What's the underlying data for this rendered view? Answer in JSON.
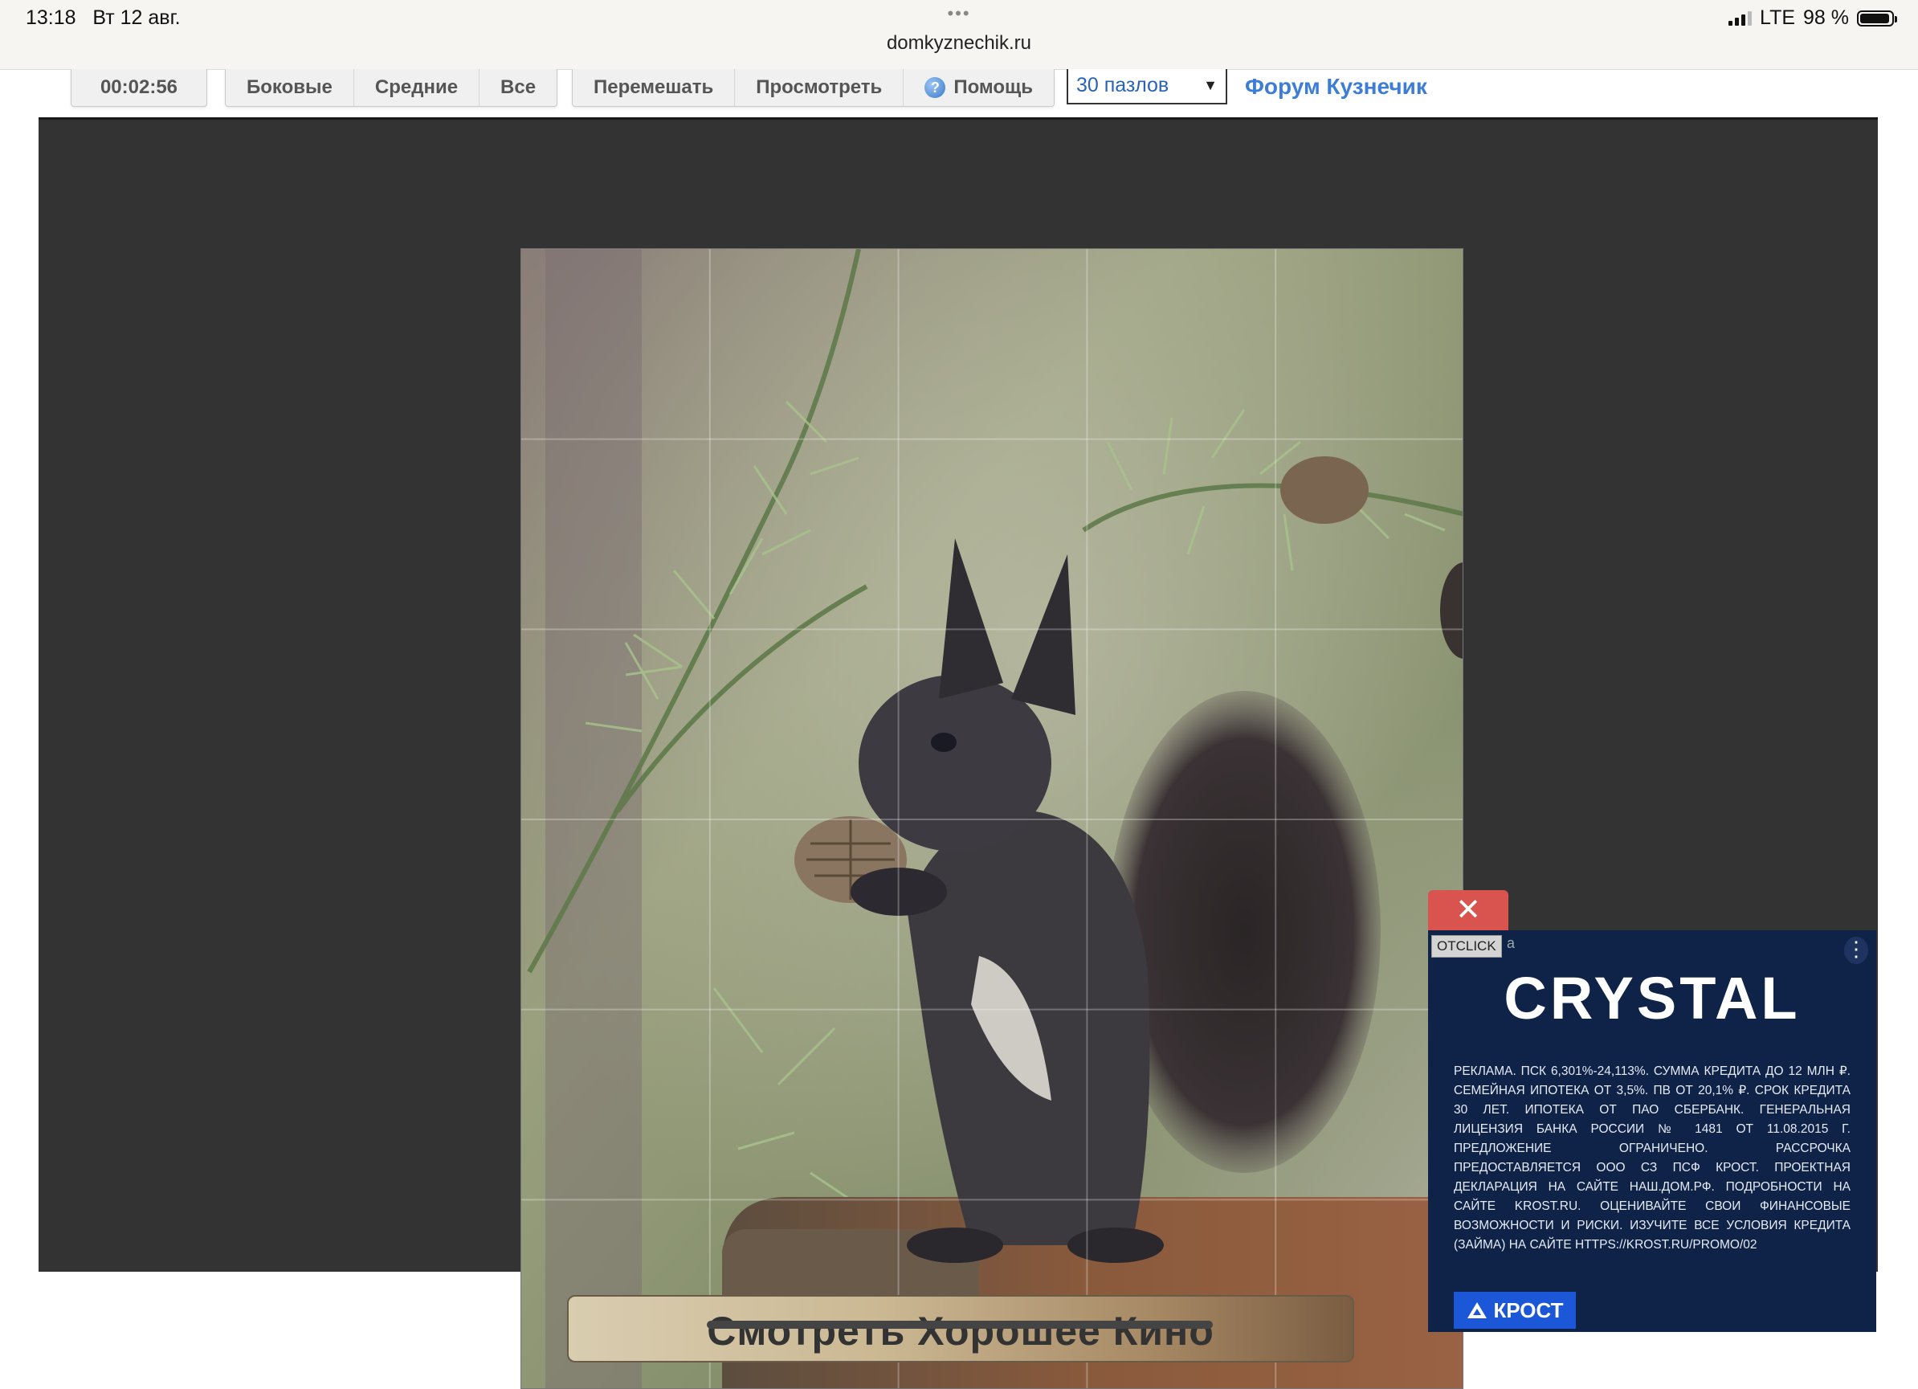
{
  "status_bar": {
    "time": "13:18",
    "date": "Вт 12 авг.",
    "url": "domkyznechik.ru",
    "network": "LTE",
    "battery": "98 %"
  },
  "toolbar": {
    "timer": "00:02:56",
    "filter_buttons": [
      "Боковые",
      "Средние",
      "Все"
    ],
    "action_buttons": [
      "Перемешать",
      "Просмотреть",
      "Помощь"
    ],
    "pieces_select": "30 пазлов",
    "forum_link": "Форум Кузнечик"
  },
  "puzzle": {
    "columns": 5,
    "rows": 6
  },
  "banner": {
    "label": "Смотреть Хорошее Кино"
  },
  "ad": {
    "close_symbol": "✕",
    "tag": "OTCLICK",
    "tag_tail": "a",
    "brand": "CRYSTAL",
    "disclaimer": "РЕКЛАМА. ПСК 6,301%-24,113%. СУММА КРЕДИТА ДО 12 МЛН ₽. СЕМЕЙНАЯ ИПОТЕКА ОТ 3,5%. ПВ ОТ 20,1% ₽. СРОК КРЕДИТА 30 ЛЕТ. ИПОТЕКА ОТ ПАО СБЕРБАНК. ГЕНЕРАЛЬНАЯ ЛИЦЕНЗИЯ БАНКА РОССИИ № 1481 ОТ 11.08.2015 Г. ПРЕДЛОЖЕНИЕ ОГРАНИЧЕНО. РАССРОЧКА ПРЕДОСТАВЛЯЕТСЯ ООО СЗ ПСФ КРОСТ. ПРОЕКТНАЯ ДЕКЛАРАЦИЯ НА САЙТЕ НАШ.ДОМ.РФ. ПОДРОБНОСТИ НА САЙТЕ KROST.RU. ОЦЕНИВАЙТЕ СВОИ ФИНАНСОВЫЕ ВОЗМОЖНОСТИ И РИСКИ. ИЗУЧИТЕ ВСЕ УСЛОВИЯ КРЕДИТА (ЗАЙМА) НА САЙТЕ HTTPS://KROST.RU/PROMO/02",
    "logo": "КРОСТ"
  },
  "colors": {
    "board_bg": "#333333",
    "link": "#3d7dd8",
    "ad_bg": "#0f2248",
    "ad_close": "#d9534f",
    "krost_logo": "#1b57d6"
  }
}
